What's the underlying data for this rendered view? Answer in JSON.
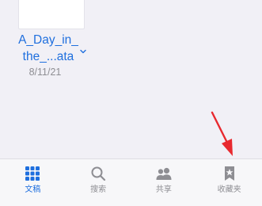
{
  "file": {
    "name_line1": "A_Day_in_",
    "name_line2": "the_...ata",
    "date": "8/11/21"
  },
  "tab_bar": {
    "tabs": [
      {
        "label": "文稿",
        "icon": "grid-icon",
        "active": true
      },
      {
        "label": "搜索",
        "icon": "search-icon",
        "active": false
      },
      {
        "label": "共享",
        "icon": "people-icon",
        "active": false
      },
      {
        "label": "收藏夹",
        "icon": "bookmark-star-icon",
        "active": false
      }
    ]
  },
  "colors": {
    "accent": "#1f6fde",
    "inactive": "#8e8e93",
    "annotation_arrow": "#e8292f",
    "background": "#f1f0f6"
  }
}
